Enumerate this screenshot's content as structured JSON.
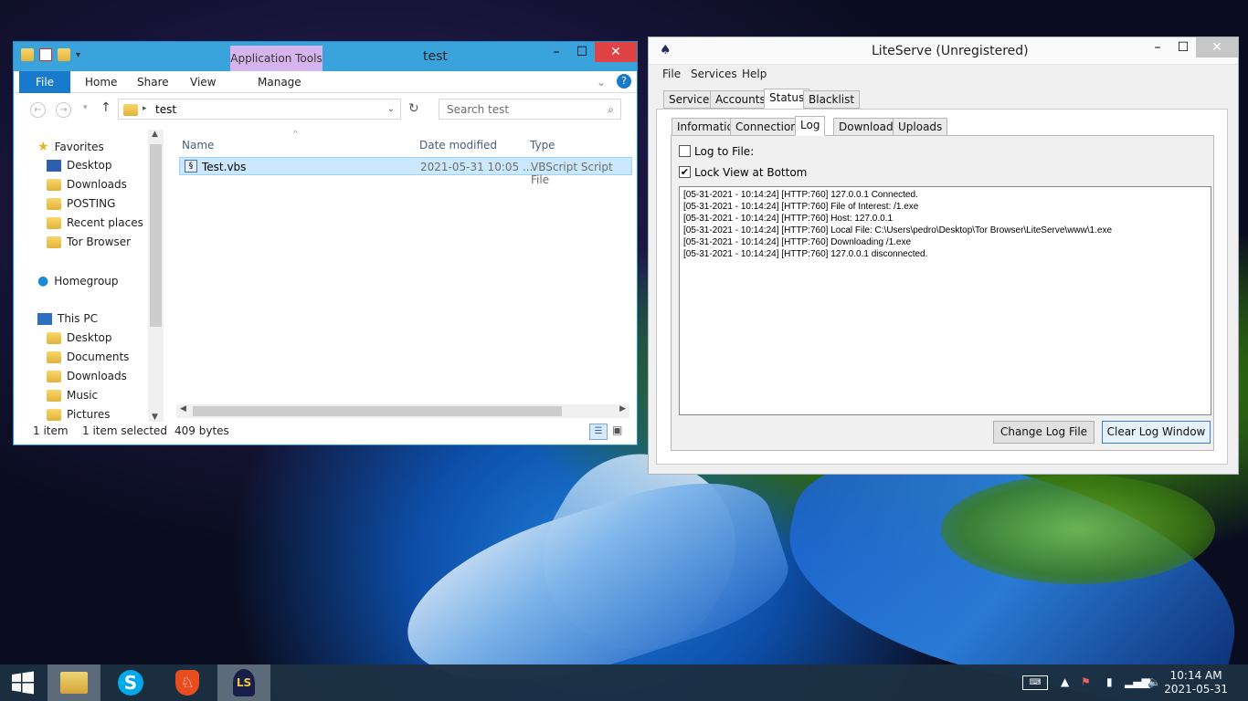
{
  "explorer": {
    "app_tools": "Application Tools",
    "title": "test",
    "ribbon": {
      "file": "File",
      "home": "Home",
      "share": "Share",
      "view": "View",
      "manage": "Manage"
    },
    "address": "test",
    "search_placeholder": "Search test",
    "nav": {
      "favorites": "Favorites",
      "fav_items": [
        "Desktop",
        "Downloads",
        "POSTING",
        "Recent places",
        "Tor Browser"
      ],
      "homegroup": "Homegroup",
      "this_pc": "This PC",
      "pc_items": [
        "Desktop",
        "Documents",
        "Downloads",
        "Music",
        "Pictures"
      ]
    },
    "columns": {
      "name": "Name",
      "date": "Date modified",
      "type": "Type"
    },
    "file": {
      "name": "Test.vbs",
      "date": "2021-05-31 10:05 ...",
      "type": "VBScript Script File"
    },
    "status": {
      "count": "1 item",
      "selected": "1 item selected",
      "size": "409 bytes"
    }
  },
  "liteserve": {
    "title": "LiteServe (Unregistered)",
    "menu": {
      "file": "File",
      "services": "Services",
      "help": "Help"
    },
    "tabs": [
      "Services",
      "Accounts",
      "Status",
      "Blacklist"
    ],
    "subtabs": [
      "Information",
      "Connections",
      "Log",
      "Downloads",
      "Uploads"
    ],
    "log_to_file": "Log to File:",
    "lock_view": "Lock View at Bottom",
    "log_lines": [
      "[05-31-2021 - 10:14:24] [HTTP:760] 127.0.0.1 Connected.",
      "[05-31-2021 - 10:14:24] [HTTP:760] File of Interest: /1.exe",
      "[05-31-2021 - 10:14:24] [HTTP:760] Host: 127.0.0.1",
      "[05-31-2021 - 10:14:24] [HTTP:760] Local File: C:\\Users\\pedro\\Desktop\\Tor Browser\\LiteServe\\www\\1.exe",
      "[05-31-2021 - 10:14:24] [HTTP:760] Downloading /1.exe",
      "[05-31-2021 - 10:14:24] [HTTP:760] 127.0.0.1 disconnected."
    ],
    "change_log": "Change Log File",
    "clear_log": "Clear Log Window"
  },
  "taskbar": {
    "time": "10:14 AM",
    "date": "2021-05-31"
  },
  "colors": {
    "accent": "#1979ca",
    "app_tools": "#d6b5ef",
    "taskbar": "#1c3042",
    "close": "#e04343"
  }
}
